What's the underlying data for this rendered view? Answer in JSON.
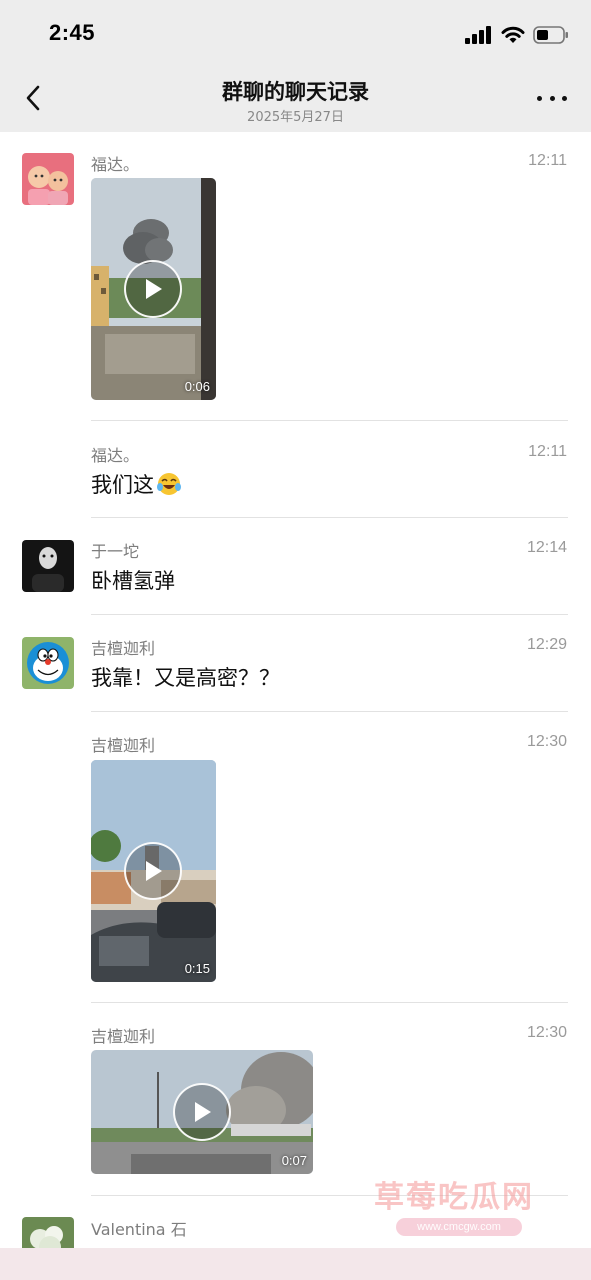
{
  "status_bar": {
    "time": "2:45"
  },
  "header": {
    "title": "群聊的聊天记录",
    "subtitle": "2025年5月27日"
  },
  "messages": [
    {
      "sender": "福达。",
      "time": "12:11",
      "video_duration": "0:06"
    },
    {
      "sender": "福达。",
      "time": "12:11",
      "text": "我们这",
      "emoji": "😂"
    },
    {
      "sender": "于一坨",
      "time": "12:14",
      "text": "卧槽氢弹"
    },
    {
      "sender": "吉檀迦利",
      "time": "12:29",
      "text": "我靠！又是高密？？"
    },
    {
      "sender": "吉檀迦利",
      "time": "12:30",
      "video_duration": "0:15"
    },
    {
      "sender": "吉檀迦利",
      "time": "12:30",
      "video_duration": "0:07"
    },
    {
      "sender": "Valentina 石"
    }
  ],
  "watermark": {
    "main": "草莓吃瓜网",
    "sub": "www.cmcgw.com"
  },
  "colors": {
    "nav_background": "#ededed",
    "bottom_bar": "#f3e7ea"
  }
}
